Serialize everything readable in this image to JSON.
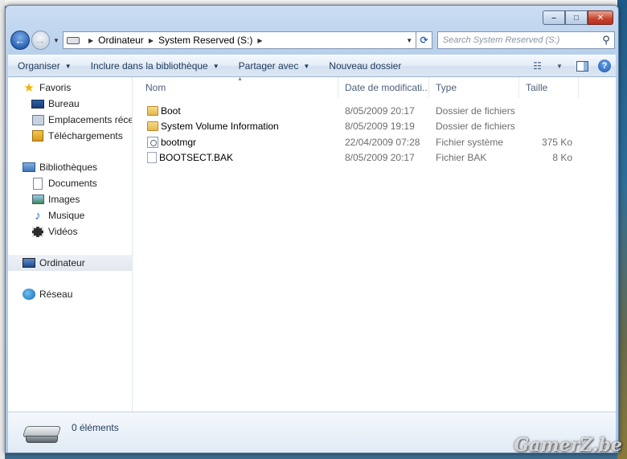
{
  "window": {
    "minimize_glyph": "–",
    "maximize_glyph": "□",
    "close_glyph": "✕"
  },
  "address_bar": {
    "back_glyph": "←",
    "forward_glyph": "→",
    "crumbs": [
      "Ordinateur",
      "System Reserved (S:)"
    ],
    "search_placeholder": "Search System Reserved (S:)"
  },
  "toolbar": {
    "organize": "Organiser",
    "include_library": "Inclure dans la bibliothèque",
    "share_with": "Partager avec",
    "new_folder": "Nouveau dossier"
  },
  "nav_pane": {
    "favorites": {
      "label": "Favoris",
      "items": [
        "Bureau",
        "Emplacements récents",
        "Téléchargements"
      ]
    },
    "libraries": {
      "label": "Bibliothèques",
      "items": [
        "Documents",
        "Images",
        "Musique",
        "Vidéos"
      ]
    },
    "computer": "Ordinateur",
    "network": "Réseau"
  },
  "columns": {
    "name": "Nom",
    "date": "Date de modificati...",
    "type": "Type",
    "size": "Taille"
  },
  "files": [
    {
      "name": "Boot",
      "date": "8/05/2009 20:17",
      "type": "Dossier de fichiers",
      "size": "",
      "icon": "folder-icon"
    },
    {
      "name": "System Volume Information",
      "date": "8/05/2009 19:19",
      "type": "Dossier de fichiers",
      "size": "",
      "icon": "folder-icon"
    },
    {
      "name": "bootmgr",
      "date": "22/04/2009 07:28",
      "type": "Fichier système",
      "size": "375 Ko",
      "icon": "system-file-icon"
    },
    {
      "name": "BOOTSECT.BAK",
      "date": "8/05/2009 20:17",
      "type": "Fichier BAK",
      "size": "8 Ko",
      "icon": "file-icon"
    }
  ],
  "details": {
    "item_count": "0 éléments"
  },
  "watermark": "GamerZ.be",
  "colors": {
    "accent": "#1e395b",
    "close_button": "#c7422c"
  }
}
